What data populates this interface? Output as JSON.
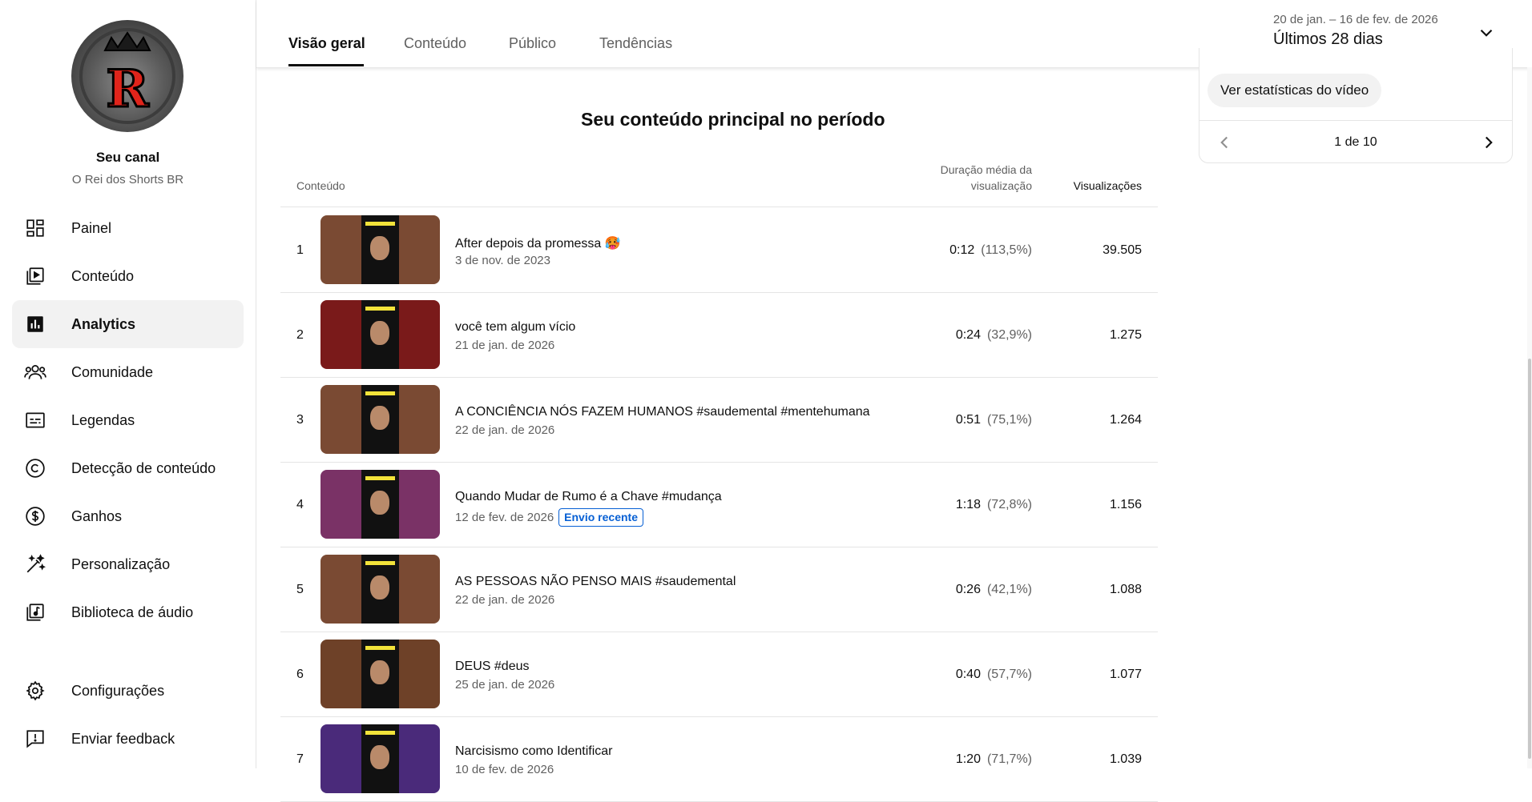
{
  "channel": {
    "title": "Seu canal",
    "name": "O Rei dos Shorts BR",
    "logo_letter": "R"
  },
  "sidebar": {
    "items": [
      {
        "label": "Painel",
        "icon": "dashboard-icon"
      },
      {
        "label": "Conteúdo",
        "icon": "content-icon"
      },
      {
        "label": "Analytics",
        "icon": "analytics-icon",
        "active": true
      },
      {
        "label": "Comunidade",
        "icon": "community-icon"
      },
      {
        "label": "Legendas",
        "icon": "subtitles-icon"
      },
      {
        "label": "Detecção de conteúdo",
        "icon": "copyright-icon"
      },
      {
        "label": "Ganhos",
        "icon": "earn-icon"
      },
      {
        "label": "Personalização",
        "icon": "customization-icon"
      },
      {
        "label": "Biblioteca de áudio",
        "icon": "audio-library-icon"
      }
    ],
    "bottom": [
      {
        "label": "Configurações",
        "icon": "settings-icon"
      },
      {
        "label": "Enviar feedback",
        "icon": "feedback-icon"
      }
    ]
  },
  "header": {
    "tabs": [
      "Visão geral",
      "Conteúdo",
      "Público",
      "Tendências"
    ],
    "active_tab": "Visão geral",
    "date_range": "20 de jan. – 16 de fev. de 2026",
    "date_label": "Últimos 28 dias"
  },
  "main": {
    "section_title": "Seu conteúdo principal no período",
    "columns": {
      "content": "Conteúdo",
      "avg_duration_line1": "Duração média da",
      "avg_duration_line2": "visualização",
      "views": "Visualizações"
    },
    "rows": [
      {
        "rank": "1",
        "title": "After depois da promessa 🥵",
        "date": "3 de nov. de 2023",
        "duration": "0:12",
        "pct": "(113,5%)",
        "views": "39.505",
        "thumb_color": "#7a4a33"
      },
      {
        "rank": "2",
        "title": "você tem algum vício",
        "date": "21 de jan. de 2026",
        "duration": "0:24",
        "pct": "(32,9%)",
        "views": "1.275",
        "thumb_color": "#7a1a1a"
      },
      {
        "rank": "3",
        "title": "A CONCIÊNCIA NÓS FAZEM HUMANOS #saudemental #mentehumana",
        "date": "22 de jan. de 2026",
        "duration": "0:51",
        "pct": "(75,1%)",
        "views": "1.264",
        "thumb_color": "#7a4a33"
      },
      {
        "rank": "4",
        "title": "Quando Mudar de Rumo é a Chave #mudança",
        "date": "12 de fev. de 2026",
        "badge": "Envio recente",
        "duration": "1:18",
        "pct": "(72,8%)",
        "views": "1.156",
        "thumb_color": "#7a3266"
      },
      {
        "rank": "5",
        "title": "AS PESSOAS NÃO PENSO MAIS #saudemental",
        "date": "22 de jan. de 2026",
        "duration": "0:26",
        "pct": "(42,1%)",
        "views": "1.088",
        "thumb_color": "#7a4a33"
      },
      {
        "rank": "6",
        "title": "DEUS #deus",
        "date": "25 de jan. de 2026",
        "duration": "0:40",
        "pct": "(57,7%)",
        "views": "1.077",
        "thumb_color": "#6e4128"
      },
      {
        "rank": "7",
        "title": "Narcisismo como Identificar",
        "date": "10 de fev. de 2026",
        "duration": "1:20",
        "pct": "(71,7%)",
        "views": "1.039",
        "thumb_color": "#4a2a7a"
      }
    ]
  },
  "card": {
    "stats_button": "Ver estatísticas do vídeo",
    "pager": "1 de 10"
  }
}
